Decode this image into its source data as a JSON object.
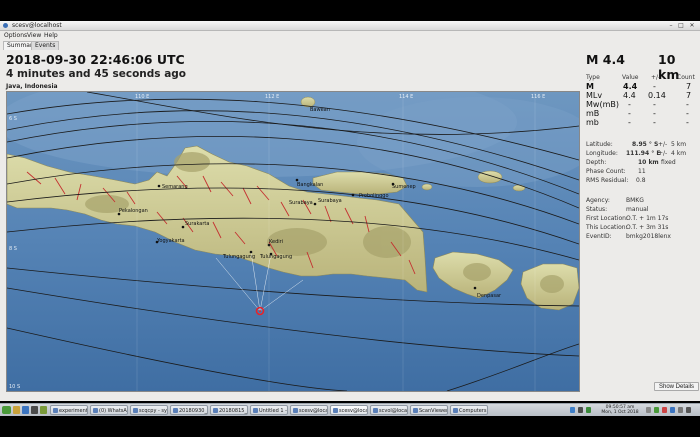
{
  "window": {
    "title": "scesv@localhost",
    "menus": [
      "Options",
      "View",
      "Help"
    ],
    "controls": [
      "–",
      "□",
      "✕"
    ]
  },
  "tabs": [
    {
      "label": "Summary",
      "active": true
    },
    {
      "label": "Events",
      "active": false
    }
  ],
  "event": {
    "datetime": "2018-09-30 22:46:06 UTC",
    "elapsed": "4 minutes and 45 seconds ago",
    "region": "Java, Indonesia",
    "magnitude_heading": "M 4.4",
    "depth_heading": "10 km"
  },
  "magnitudes": {
    "headers": {
      "type": "Type",
      "value": "Value",
      "pm": "+/-",
      "count": "Count"
    },
    "rows": [
      {
        "type": "M",
        "value": "4.4",
        "pm": "-",
        "count": "7"
      },
      {
        "type": "MLv",
        "value": "4.4",
        "pm": "0.14",
        "count": "7"
      },
      {
        "type": "Mw(mB)",
        "value": "-",
        "pm": "-",
        "count": "-"
      },
      {
        "type": "mB",
        "value": "-",
        "pm": "-",
        "count": "-"
      },
      {
        "type": "mb",
        "value": "-",
        "pm": "-",
        "count": "-"
      }
    ]
  },
  "origin": {
    "latitude": {
      "label": "Latitude:",
      "value": "8.95 ° S",
      "pm": "+/-",
      "err": "5 km"
    },
    "longitude": {
      "label": "Longitude:",
      "value": "111.94 ° E",
      "pm": "+/-",
      "err": "4 km"
    },
    "depth": {
      "label": "Depth:",
      "value": "10 km",
      "note": "fixed"
    },
    "phase_count": {
      "label": "Phase Count:",
      "value": "11"
    },
    "rms_residual": {
      "label": "RMS Residual:",
      "value": "0.8"
    },
    "agency": {
      "label": "Agency:",
      "value": "BMKG"
    },
    "status": {
      "label": "Status:",
      "value": "manual"
    },
    "first_location": {
      "label": "First Location:",
      "value": "O.T. + 1m 17s"
    },
    "this_location": {
      "label": "This Location:",
      "value": "O.T. + 3m 31s"
    },
    "event_id": {
      "label": "EventID:",
      "value": "bmkg2018lenx"
    }
  },
  "buttons": {
    "show_details": "Show Details"
  },
  "map": {
    "cities": [
      "Semarang",
      "Surabaya",
      "Surabaya",
      "Sumenep",
      "Surakarta",
      "Yogyakarta",
      "Kediri",
      "Tulungagung",
      "Tulungagung",
      "Denpasar",
      "Pekalongan",
      "Probolinggo",
      "Bawean",
      "Bangkalan"
    ],
    "lat_labels": [
      "6 S",
      "8 S",
      "10 S"
    ],
    "lon_labels": [
      "110 E",
      "112 E",
      "114 E",
      "116 E"
    ],
    "colors": {
      "sea": "#4f7fb0",
      "land": "#cfcf93",
      "fault": "#c43030",
      "epicenter": "#e8232a",
      "track": "#1a1a1a"
    }
  },
  "taskbar": {
    "tasks": [
      "experiment",
      "(0) WhatsApp",
      "scqcpy - sysop",
      "20180930_",
      "20180815_",
      "Untitled 1 - Li",
      "scesv@local",
      "scesv@local",
      "scvol@local",
      "ScanViewer",
      "Computers 3"
    ],
    "clock_time": "09:50:57 am",
    "clock_date": "Mon, 1 Oct 2018"
  }
}
